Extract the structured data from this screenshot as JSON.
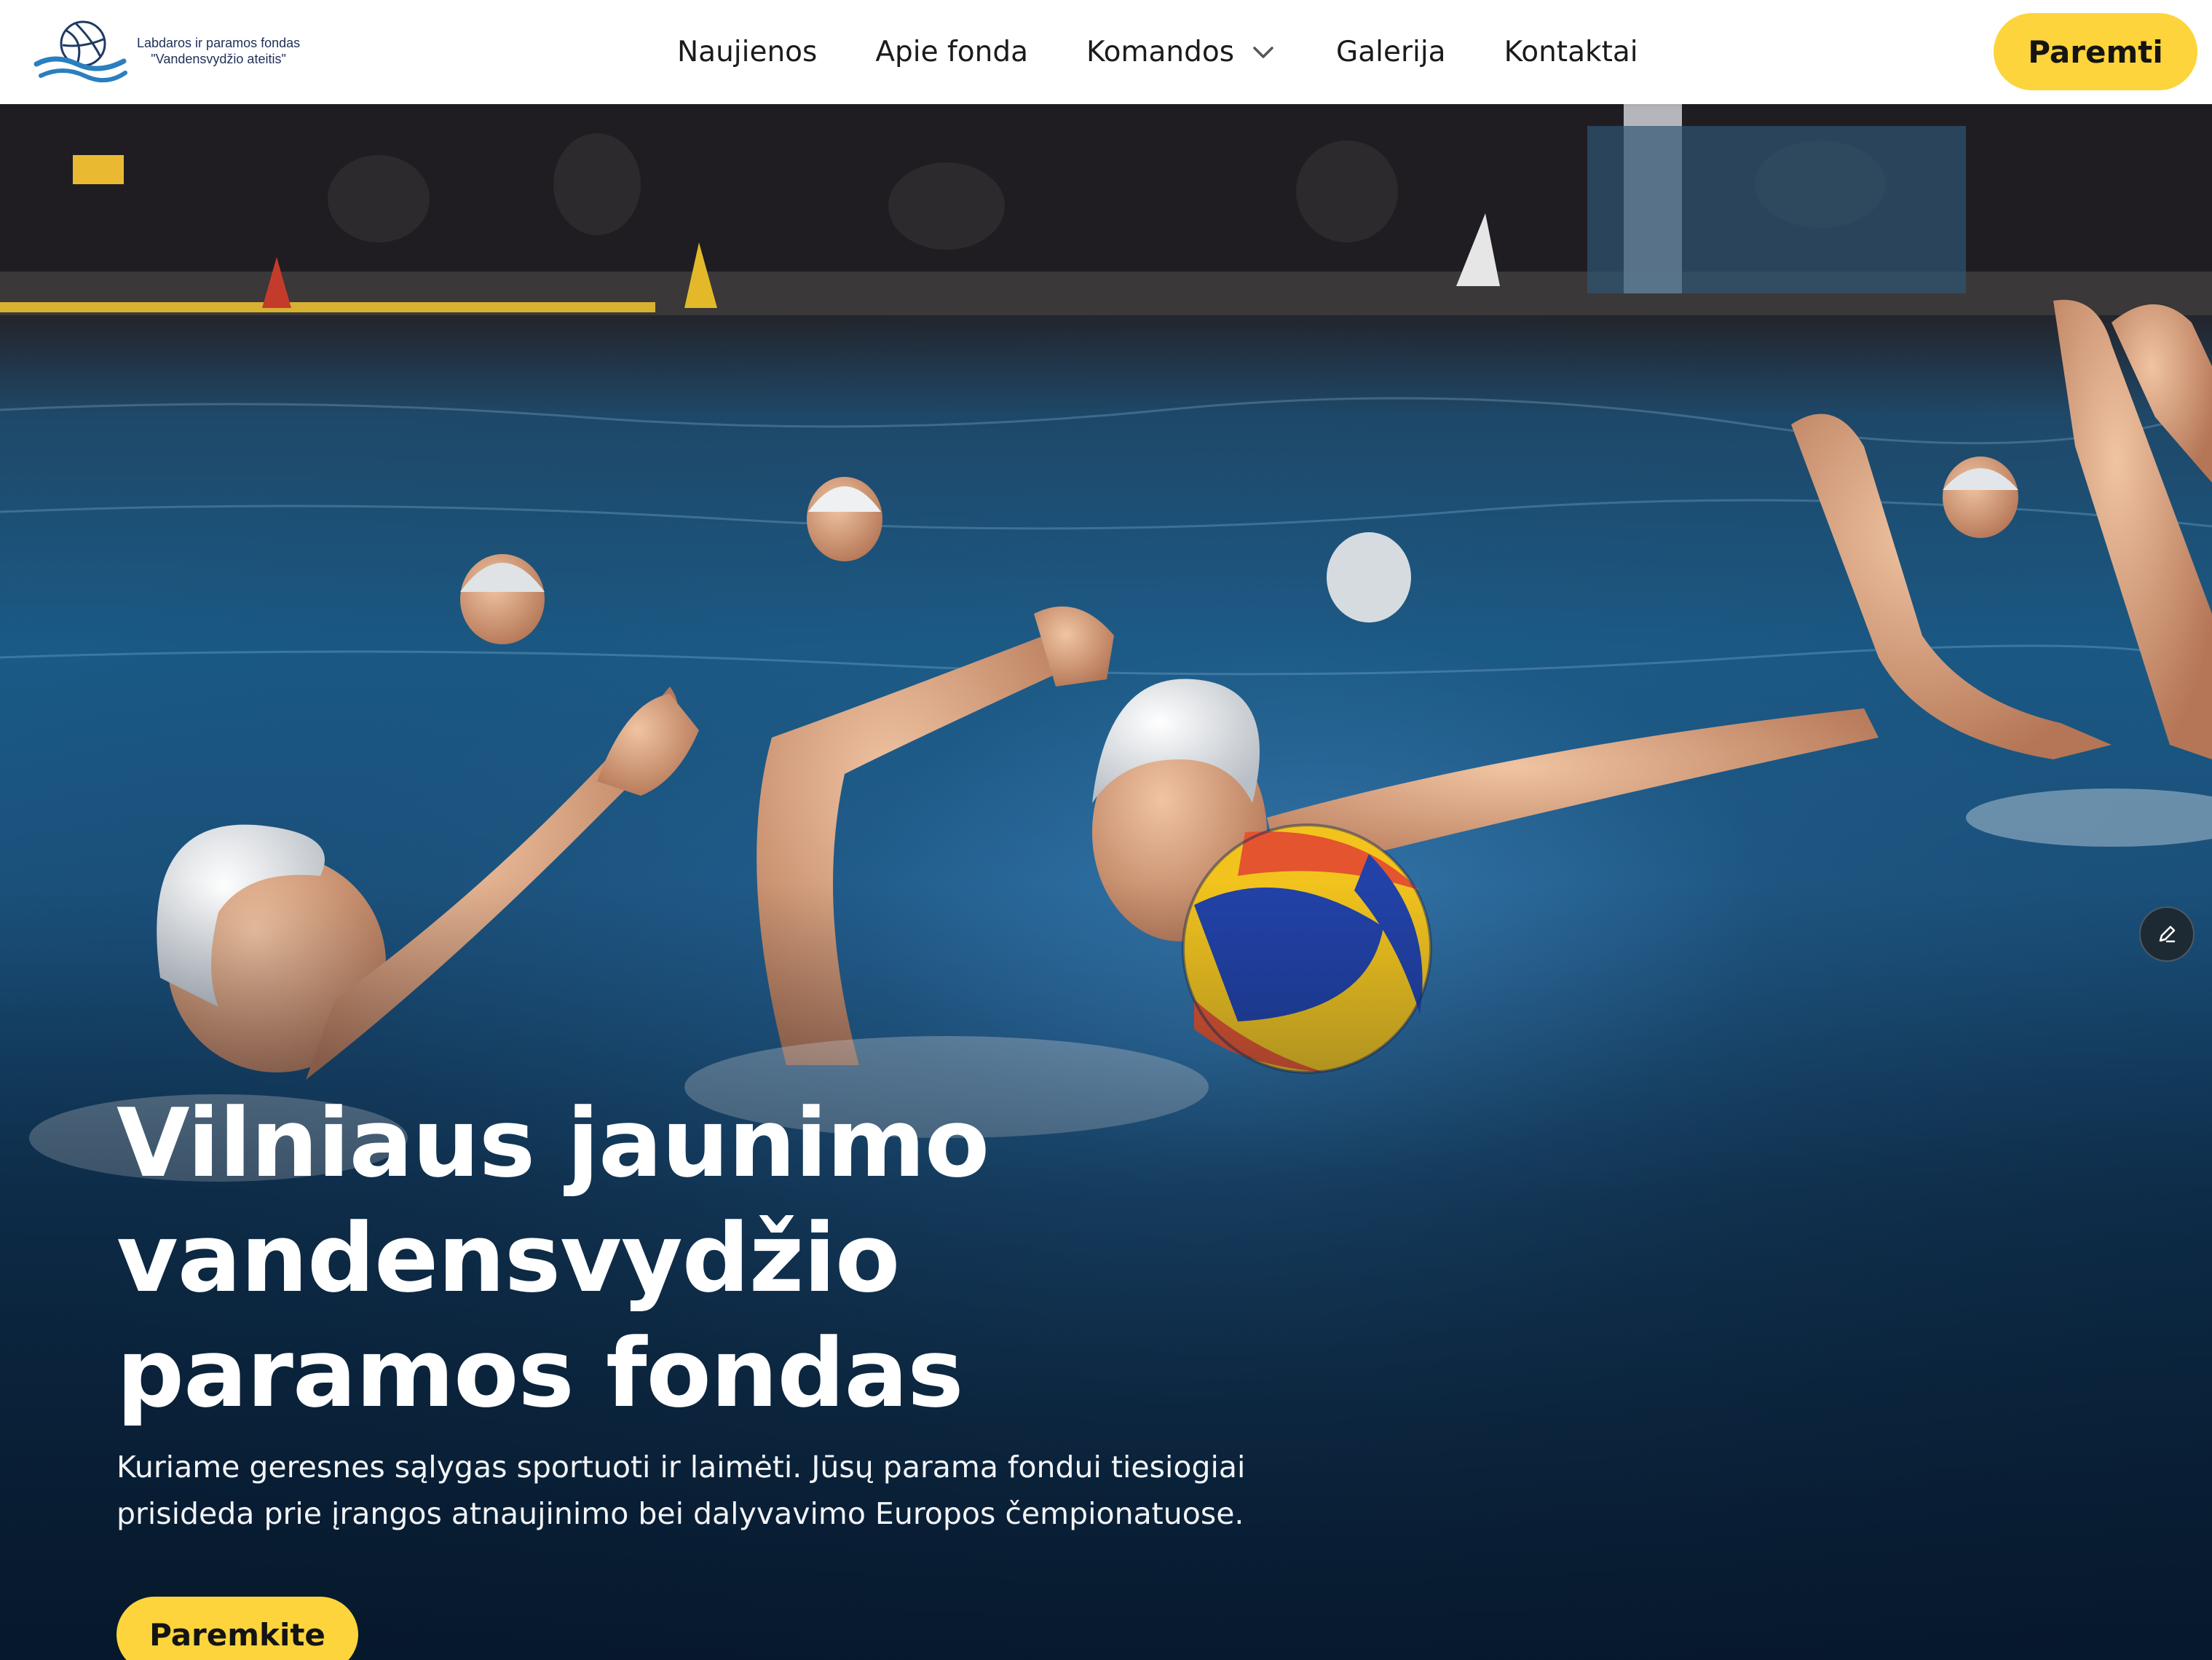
{
  "brand": {
    "line1": "Labdaros ir paramos fondas",
    "line2": "\"Vandensvydžio ateitis\""
  },
  "nav": {
    "items": [
      {
        "label": "Naujienos"
      },
      {
        "label": "Apie fonda"
      },
      {
        "label": "Komandos",
        "icon": "chevron-down-icon"
      },
      {
        "label": "Galerija"
      },
      {
        "label": "Kontaktai"
      }
    ],
    "cta_label": "Paremti"
  },
  "hero": {
    "title_line1": "Vilniaus jaunimo vandensvydžio",
    "title_line2": "paramos fondas",
    "subtitle_line1": "Kuriame geresnes sąlygas sportuoti ir laimėti. Jūsų parama fondui tiesiogiai",
    "subtitle_line2": "prisideda prie įrangos atnaujinimo bei dalyvavimo Europos čempionatuose.",
    "cta_label": "Paremkite",
    "edit_icon": "pencil-icon"
  },
  "colors": {
    "accent": "#fdd43b",
    "header_bg": "#ffffff",
    "brand_text": "#1f2f57",
    "logo_blue": "#2a7fc0"
  }
}
